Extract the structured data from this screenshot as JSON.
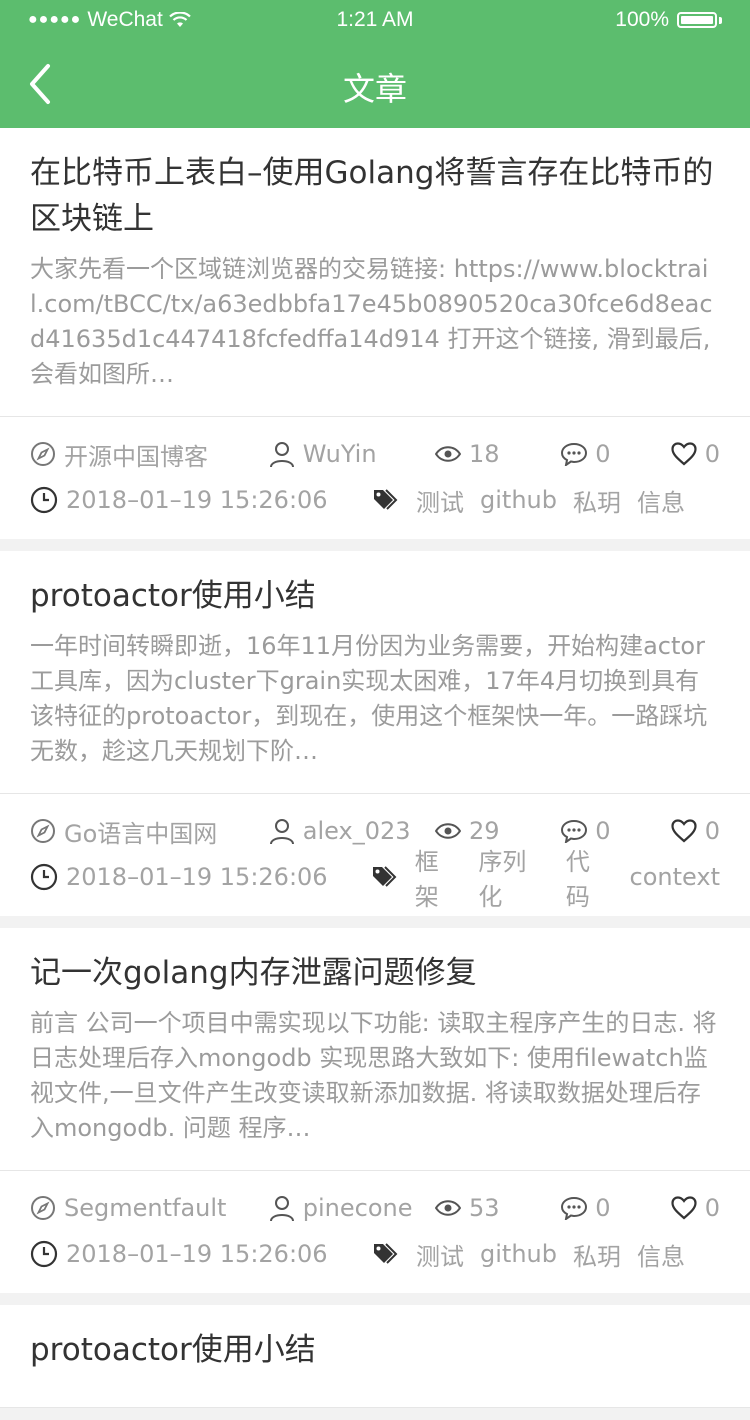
{
  "status_bar": {
    "carrier": "WeChat",
    "time": "1:21 AM",
    "battery": "100%"
  },
  "nav": {
    "title": "文章"
  },
  "articles": [
    {
      "title": "在比特币上表白–使用Golang将誓言存在比特币的区块链上",
      "summary": "大家先看一个区域链浏览器的交易链接: https://www.blocktrail.com/tBCC/tx/a63edbbfa17e45b0890520ca30fce6d8eacd41635d1c447418fcfedffa14d914 打开这个链接, 滑到最后, 会看如图所…",
      "source": "开源中国博客",
      "author": "WuYin",
      "views": "18",
      "comments": "0",
      "likes": "0",
      "date": "2018–01–19 15:26:06",
      "tags": [
        "测试",
        "github",
        "私玥",
        "信息"
      ]
    },
    {
      "title": "protoactor使用小结",
      "summary": "一年时间转瞬即逝，16年11月份因为业务需要，开始构建actor工具库，因为cluster下grain实现太困难，17年4月切换到具有该特征的protoactor，到现在，使用这个框架快一年。一路踩坑无数，趁这几天规划下阶…",
      "source": "Go语言中国网",
      "author": "alex_023",
      "views": "29",
      "comments": "0",
      "likes": "0",
      "date": "2018–01–19 15:26:06",
      "tags": [
        "框架",
        "序列化",
        "代码",
        "context"
      ]
    },
    {
      "title": "记一次golang内存泄露问题修复",
      "summary": "前言 公司一个项目中需实现以下功能: 读取主程序产生的日志. 将日志处理后存入mongodb 实现思路大致如下: 使用filewatch监视文件,一旦文件产生改变读取新添加数据. 将读取数据处理后存入mongodb. 问题 程序…",
      "source": "Segmentfault",
      "author": "pinecone",
      "views": "53",
      "comments": "0",
      "likes": "0",
      "date": "2018–01–19 15:26:06",
      "tags": [
        "测试",
        "github",
        "私玥",
        "信息"
      ]
    },
    {
      "title": "protoactor使用小结"
    }
  ],
  "icons": {
    "source": "compass-icon",
    "author": "user-icon",
    "views": "eye-icon",
    "comments": "comment-icon",
    "likes": "heart-icon",
    "date": "clock-icon",
    "tags": "tag-icon"
  },
  "colors": {
    "brand": "#5cbd6e",
    "summary_text": "#9b9b9b",
    "meta_text": "#a3a3a3"
  }
}
